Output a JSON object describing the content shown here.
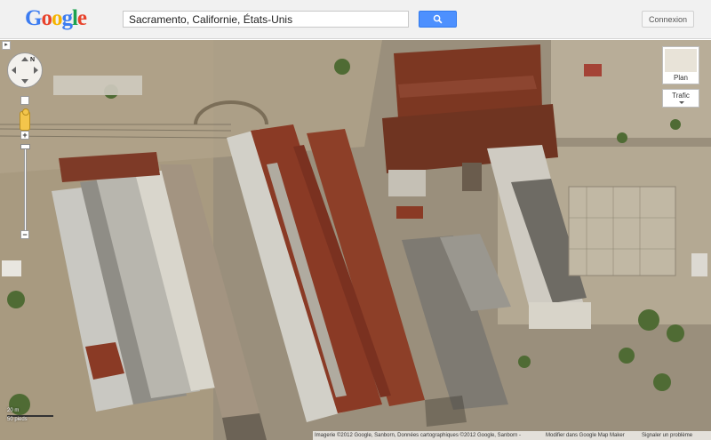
{
  "header": {
    "logo_letters": [
      {
        "char": "G",
        "color": "#3c7cf1"
      },
      {
        "char": "o",
        "color": "#e8432c"
      },
      {
        "char": "o",
        "color": "#f5b400"
      },
      {
        "char": "g",
        "color": "#3c7cf1"
      },
      {
        "char": "l",
        "color": "#1aa14f"
      },
      {
        "char": "e",
        "color": "#e8432c"
      }
    ],
    "search_value": "Sacramento, Californie, États-Unis",
    "search_button_icon": "search-icon",
    "signin_label": "Connexion"
  },
  "map_controls": {
    "nav_toggle": "▸",
    "compass_label": "N",
    "zoom_in": "+",
    "zoom_out": "−",
    "plan_label": "Plan",
    "trafic_label": "Trafic"
  },
  "scale": {
    "top": "20 m",
    "bottom": "50 pieds"
  },
  "footer": {
    "attribution": "Imagerie ©2012 Google, Sanborn, Données cartographiques ©2012 Google, Sanborn -",
    "modify_link": "Modifier dans Google Map Maker",
    "report_link": "Signaler un problème"
  },
  "colors": {
    "accent_blue": "#4d90fe",
    "rust_roof": "#8a3a25",
    "header_bg": "#f1f1f1"
  }
}
